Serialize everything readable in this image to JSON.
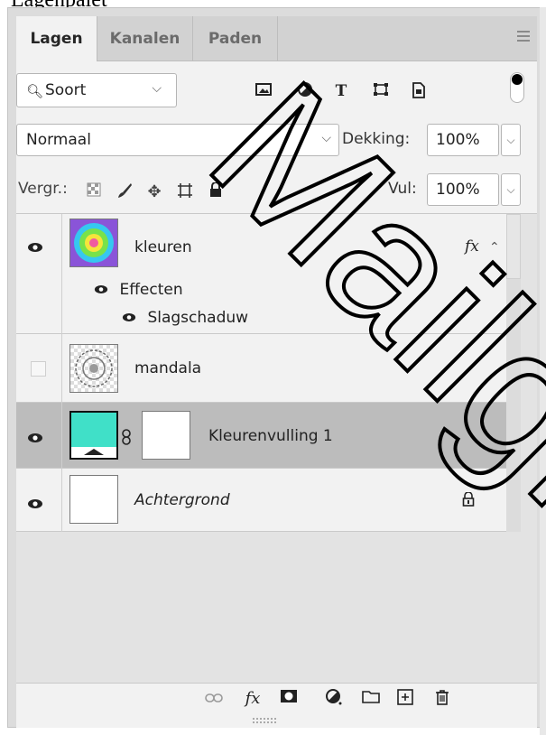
{
  "caption": "Lagenpalet",
  "tabs": [
    {
      "label": "Lagen",
      "active": true
    },
    {
      "label": "Kanalen",
      "active": false
    },
    {
      "label": "Paden",
      "active": false
    }
  ],
  "filter": {
    "kind_label": "Soort",
    "icons": [
      "image-icon",
      "adjustment-icon",
      "type-icon",
      "shape-icon",
      "smart-object-icon"
    ]
  },
  "blend": {
    "mode": "Normaal",
    "opacity_label": "Dekking:",
    "opacity_value": "100%",
    "fill_label": "Vul:",
    "fill_value": "100%"
  },
  "lock": {
    "label": "Vergr.:"
  },
  "layers": [
    {
      "name": "kleuren",
      "visible": true,
      "fx": "fx",
      "effects_label": "Effecten",
      "effect": "Slagschaduw"
    },
    {
      "name": "mandala",
      "visible": false
    },
    {
      "name": "Kleurenvulling 1",
      "visible": true,
      "selected": true,
      "fill_color": "#40e0c8"
    },
    {
      "name": "Achtergrond",
      "visible": true,
      "locked": true
    }
  ],
  "toolbar": {
    "fx_label": "fx"
  },
  "watermark": "Mailgrl Cr",
  "colors": {
    "panel": "#f2f2f2",
    "selected": "#bcbcbc",
    "fill": "#40e0c8"
  }
}
